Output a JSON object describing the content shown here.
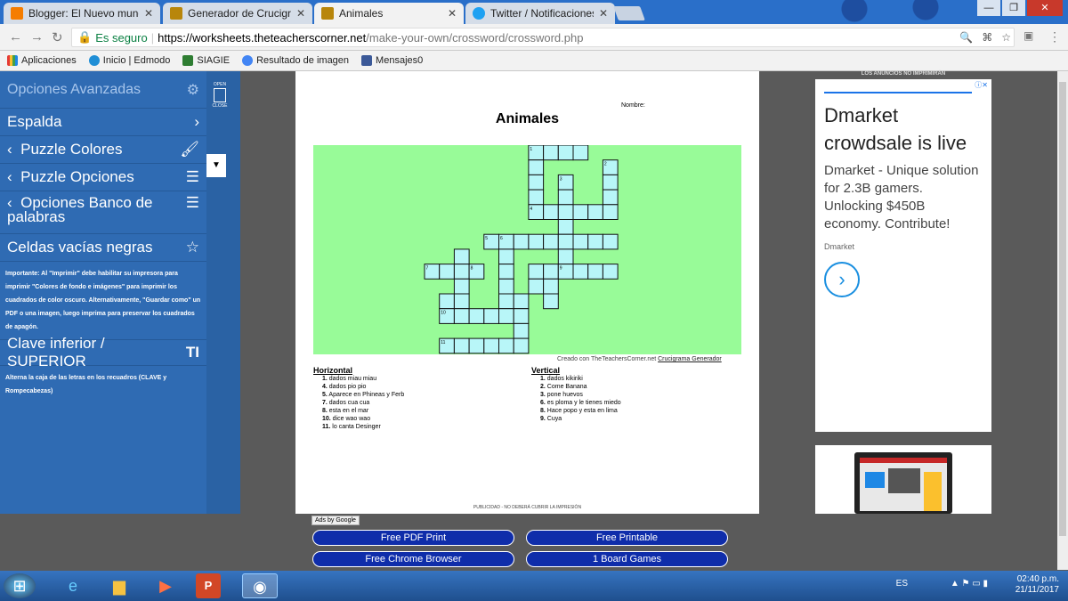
{
  "browser": {
    "tabs": [
      {
        "title": "Blogger: El Nuevo mund",
        "color": "#f57d00",
        "active": false
      },
      {
        "title": "Generador de Crucigram",
        "color": "#b8860b",
        "active": false
      },
      {
        "title": "Animales",
        "color": "#b8860b",
        "active": true
      },
      {
        "title": "Twitter / Notificaciones",
        "color": "#1da1f2",
        "active": false
      }
    ],
    "secure_label": "Es seguro",
    "url_host": "https://worksheets.theteacherscorner.net",
    "url_path": "/make-your-own/crossword/crossword.php",
    "bookmarks": [
      "Aplicaciones",
      "Inicio | Edmodo",
      "SIAGIE",
      "Resultado de imagen",
      "Mensajes0"
    ]
  },
  "sidebar": {
    "header": "Opciones Avanzadas",
    "items": [
      {
        "label": "Espalda",
        "prefix": "",
        "icon": ">"
      },
      {
        "label": "Puzzle Colores",
        "prefix": "<",
        "icon": "brush-icon"
      },
      {
        "label": "Puzzle Opciones",
        "prefix": "<",
        "icon": "sliders-icon"
      },
      {
        "label": "Opciones Banco de palabras",
        "prefix": "<",
        "icon": "sliders-icon"
      },
      {
        "label": "Celdas vacías negras",
        "prefix": "",
        "icon": "star-icon"
      }
    ],
    "note1": "Importante: Al \"Imprimir\" debe habilitar su impresora para imprimir \"Colores de fondo e imágenes\" para imprimir los cuadrados de color oscuro. Alternativamente, \"Guardar como\" un PDF o una imagen, luego imprima para preservar los cuadrados de apagón.",
    "clave_label": "Clave inferior / SUPERIOR",
    "note2": "Alterna la caja de las letras en los recuadros (CLAVE y Rompecabezas)",
    "open_label": "OPEN",
    "close_label": "CLOSE"
  },
  "worksheet": {
    "nombre_label": "Nombre:",
    "title": "Animales",
    "grid_color": "#98fb98",
    "cell_color": "#b8f6f8",
    "credit": "Creado con TheTeachersCorner.net",
    "credit_link": "Crucigrama Generador",
    "horizontal_title": "Horizontal",
    "horizontal": [
      {
        "num": "1.",
        "text": "dados miau miau"
      },
      {
        "num": "4.",
        "text": "dados pio pio"
      },
      {
        "num": "5.",
        "text": "Aparece en Phineas y Ferb"
      },
      {
        "num": "7.",
        "text": "dados cua cua"
      },
      {
        "num": "8.",
        "text": "esta en el mar"
      },
      {
        "num": "10.",
        "text": "dice wao wao"
      },
      {
        "num": "11.",
        "text": "lo canta Desinger"
      }
    ],
    "vertical_title": "Vertical",
    "vertical": [
      {
        "num": "1.",
        "text": "dados kikiriki"
      },
      {
        "num": "2.",
        "text": "Come Banana"
      },
      {
        "num": "3.",
        "text": "pone huevos"
      },
      {
        "num": "6.",
        "text": "es ploma y le tienes miedo"
      },
      {
        "num": "8.",
        "text": "Hace popo y esta en lima"
      },
      {
        "num": "9.",
        "text": "Cuya"
      }
    ],
    "footer_note": "PUBLICIDAD - NO DEBERÁ CUBRIR LA IMPRESIÓN",
    "ads_by": "Ads by Google"
  },
  "crossword": {
    "numbers": {
      "1": [
        0,
        7
      ],
      "2": [
        1,
        12
      ],
      "3": [
        2,
        9
      ],
      "4": [
        4,
        7
      ],
      "5": [
        6,
        4
      ],
      "6": [
        6,
        5
      ],
      "7": [
        8,
        0
      ],
      "8": [
        8,
        3
      ],
      "9": [
        8,
        9
      ],
      "10": [
        11,
        1
      ],
      "11": [
        13,
        1
      ]
    },
    "cells": [
      [
        0,
        7
      ],
      [
        0,
        8
      ],
      [
        0,
        9
      ],
      [
        0,
        10
      ],
      [
        1,
        7
      ],
      [
        1,
        12
      ],
      [
        2,
        7
      ],
      [
        2,
        9
      ],
      [
        2,
        12
      ],
      [
        3,
        7
      ],
      [
        3,
        9
      ],
      [
        3,
        12
      ],
      [
        4,
        7
      ],
      [
        4,
        8
      ],
      [
        4,
        9
      ],
      [
        4,
        10
      ],
      [
        4,
        11
      ],
      [
        4,
        12
      ],
      [
        5,
        9
      ],
      [
        6,
        4
      ],
      [
        6,
        5
      ],
      [
        6,
        6
      ],
      [
        6,
        7
      ],
      [
        6,
        8
      ],
      [
        6,
        9
      ],
      [
        6,
        10
      ],
      [
        6,
        11
      ],
      [
        6,
        12
      ],
      [
        7,
        2
      ],
      [
        7,
        5
      ],
      [
        7,
        9
      ],
      [
        8,
        0
      ],
      [
        8,
        1
      ],
      [
        8,
        2
      ],
      [
        8,
        3
      ],
      [
        8,
        5
      ],
      [
        8,
        7
      ],
      [
        8,
        8
      ],
      [
        8,
        9
      ],
      [
        8,
        10
      ],
      [
        8,
        11
      ],
      [
        8,
        12
      ],
      [
        9,
        2
      ],
      [
        9,
        5
      ],
      [
        9,
        7
      ],
      [
        9,
        8
      ],
      [
        10,
        1
      ],
      [
        10,
        2
      ],
      [
        10,
        5
      ],
      [
        10,
        6
      ],
      [
        10,
        8
      ],
      [
        11,
        1
      ],
      [
        11,
        2
      ],
      [
        11,
        3
      ],
      [
        11,
        4
      ],
      [
        11,
        5
      ],
      [
        11,
        6
      ],
      [
        12,
        6
      ],
      [
        13,
        1
      ],
      [
        13,
        2
      ],
      [
        13,
        3
      ],
      [
        13,
        4
      ],
      [
        13,
        5
      ],
      [
        13,
        6
      ]
    ]
  },
  "ad": {
    "top_note": "LOS ANUNCIOS NO IMPRIMIRÁN",
    "headline": "Dmarket crowdsale is live",
    "body": "Dmarket - Unique solution for 2.3B gamers. Unlocking $450B economy. Contribute!",
    "source": "Dmarket"
  },
  "print_buttons": [
    "Free PDF Print",
    "Free Printable",
    "Free Chrome Browser",
    "1 Board Games"
  ],
  "taskbar": {
    "lang": "ES",
    "time": "02:40 p.m.",
    "date": "21/11/2017"
  }
}
